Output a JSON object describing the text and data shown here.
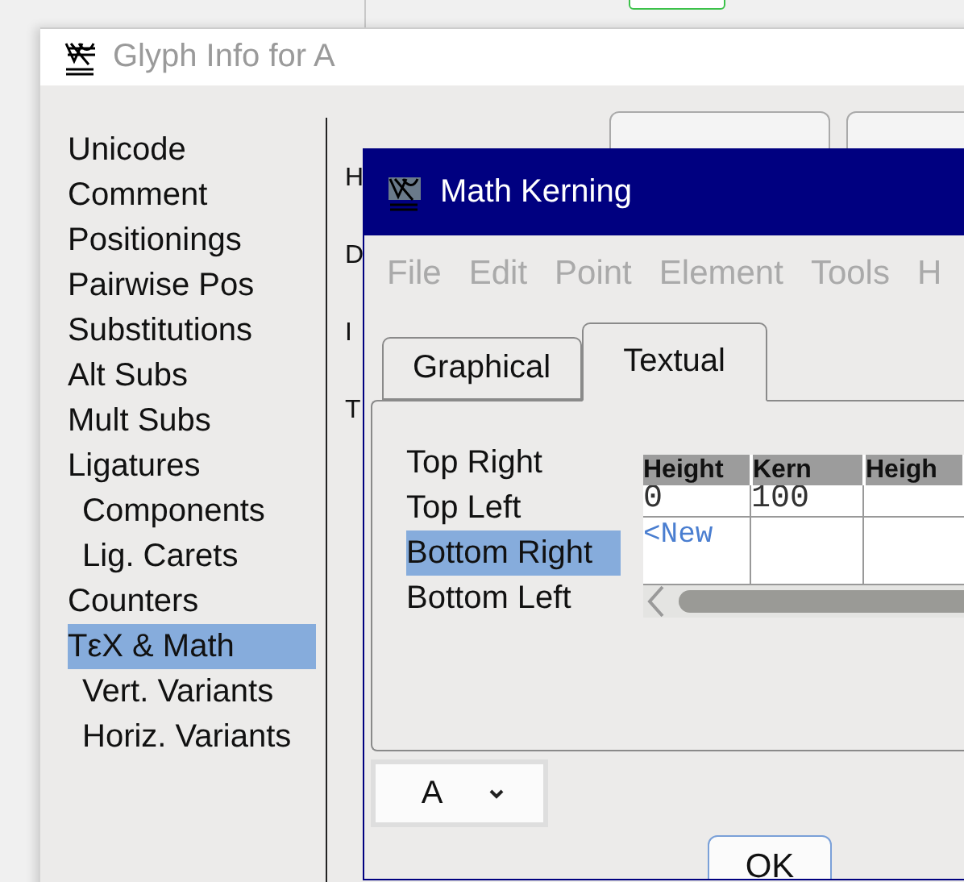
{
  "glyph_info": {
    "title": "Glyph Info for A",
    "sidebar": {
      "items": [
        {
          "label": "Unicode",
          "selected": false
        },
        {
          "label": "Comment",
          "selected": false
        },
        {
          "label": "Positionings",
          "selected": false
        },
        {
          "label": "Pairwise Pos",
          "selected": false
        },
        {
          "label": "Substitutions",
          "selected": false
        },
        {
          "label": "Alt Subs",
          "selected": false
        },
        {
          "label": "Mult Subs",
          "selected": false
        },
        {
          "label": "Ligatures",
          "selected": false,
          "children": [
            {
              "label": "Components",
              "selected": false
            },
            {
              "label": "Lig. Carets",
              "selected": false
            }
          ]
        },
        {
          "label": "Counters",
          "selected": false
        },
        {
          "label": "TεX & Math",
          "selected": true,
          "children": [
            {
              "label": "Vert. Variants",
              "selected": false
            },
            {
              "label": "Horiz. Variants",
              "selected": false
            }
          ]
        }
      ]
    },
    "field_labels": [
      "H",
      "D",
      "I",
      "T"
    ]
  },
  "math_kerning": {
    "title": "Math Kerning",
    "menu": [
      {
        "label": "File",
        "disabled": true
      },
      {
        "label": "Edit",
        "disabled": true
      },
      {
        "label": "Point",
        "disabled": true
      },
      {
        "label": "Element",
        "disabled": true
      },
      {
        "label": "Tools",
        "disabled": true
      },
      {
        "label": "H",
        "disabled": true
      }
    ],
    "tabs": [
      {
        "label": "Graphical",
        "selected": false
      },
      {
        "label": "Textual",
        "selected": true
      }
    ],
    "corners": [
      {
        "label": "Top Right",
        "selected": false
      },
      {
        "label": "Top Left",
        "selected": false
      },
      {
        "label": "Bottom Right",
        "selected": true
      },
      {
        "label": "Bottom Left",
        "selected": false
      }
    ],
    "table": {
      "columns": [
        "Height",
        "Kern",
        "Heigh"
      ],
      "rows": [
        {
          "kind": "entry",
          "cells": [
            "0",
            "100"
          ]
        },
        {
          "kind": "new",
          "cells": [
            "<New"
          ]
        }
      ]
    },
    "glyph_select": {
      "value": "A"
    },
    "buttons": [
      "OK"
    ]
  }
}
